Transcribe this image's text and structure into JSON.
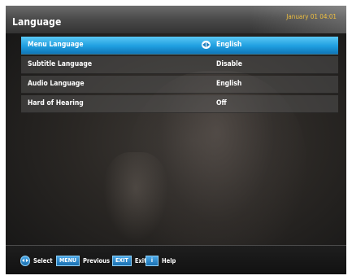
{
  "header": {
    "title": "Language",
    "datetime": "January 01 04:01"
  },
  "menu": {
    "items": [
      {
        "label": "Menu Language",
        "value": "English",
        "selected": true
      },
      {
        "label": "Subtitle Language",
        "value": "Disable",
        "selected": false
      },
      {
        "label": "Audio Language",
        "value": "English",
        "selected": false
      },
      {
        "label": "Hard of Hearing",
        "value": "Off",
        "selected": false
      }
    ]
  },
  "footer": {
    "select": {
      "icon": "left-right-arrows-icon",
      "label": "Select"
    },
    "menu": {
      "key": "MENU",
      "label": "Previous Menu"
    },
    "exit": {
      "key": "EXIT",
      "label": "Exit"
    },
    "help": {
      "key": "i",
      "label": "Help"
    }
  },
  "colors": {
    "accent": "#1f9fe0",
    "clock": "#f0c040"
  }
}
